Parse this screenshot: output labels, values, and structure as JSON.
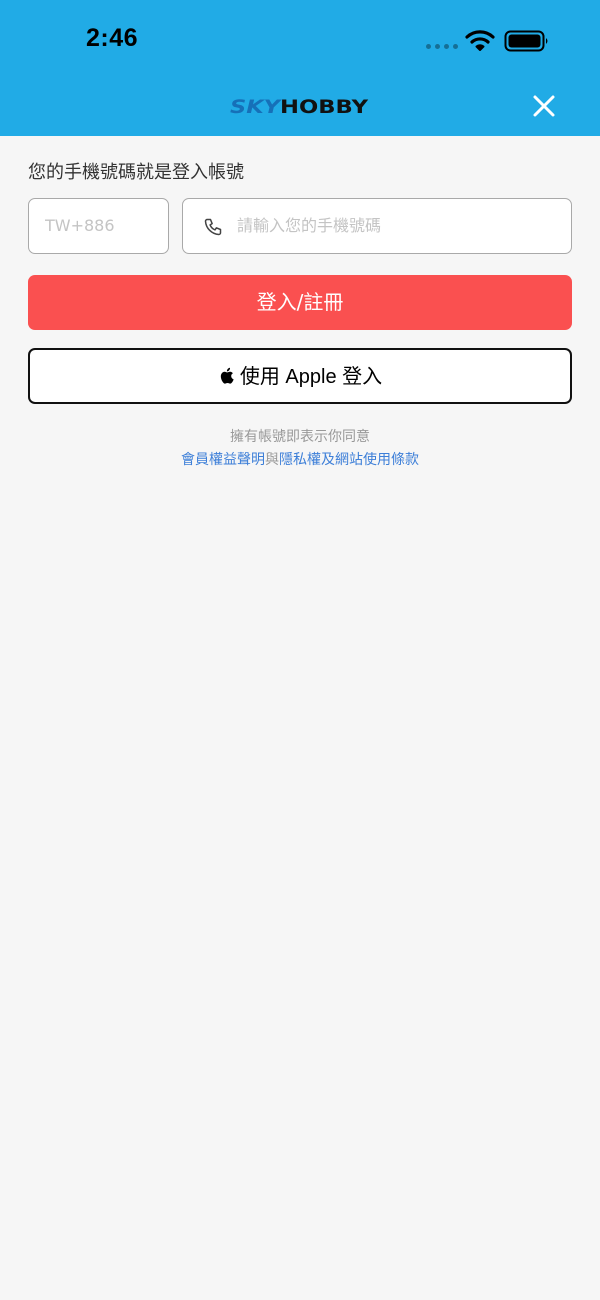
{
  "status_bar": {
    "time": "2:46"
  },
  "header": {
    "logo_text": "SKYHOBBY",
    "logo_part_sky": "SKY",
    "logo_part_hobby": "HOBBY",
    "close_icon": "close-icon",
    "background_color": "#21abe6"
  },
  "login": {
    "prompt": "您的手機號碼就是登入帳號",
    "country_code_placeholder": "TW+886",
    "phone_placeholder": "請輸入您的手機號碼",
    "phone_icon": "phone-icon",
    "login_button_label": "登入/註冊",
    "login_button_color": "#fa5050",
    "apple_button_label": "使用 Apple 登入",
    "apple_icon": "apple-icon"
  },
  "terms": {
    "notice": "擁有帳號即表示你同意",
    "link_member_rights": "會員權益聲明",
    "conjunction": "與",
    "link_privacy_terms": "隱私權及網站使用條款",
    "link_color": "#3d7fd8"
  }
}
